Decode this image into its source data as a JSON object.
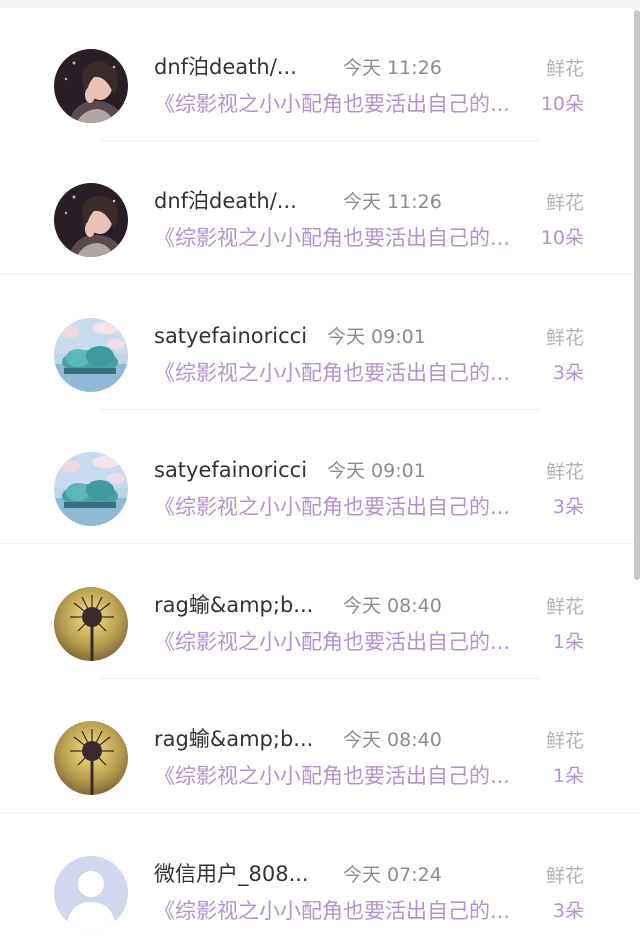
{
  "rows": [
    {
      "name": "dnf泊death/...",
      "time": "今天 11:26",
      "gift_label": "鲜花",
      "novel": "《综影视之小小配角也要活出自己的...",
      "count": "10朵",
      "avatar": "portrait"
    },
    {
      "name": "dnf泊death/...",
      "time": "今天 11:26",
      "gift_label": "鲜花",
      "novel": "《综影视之小小配角也要活出自己的...",
      "count": "10朵",
      "avatar": "portrait"
    },
    {
      "name": "satyefainoricci",
      "time": "今天 09:01",
      "gift_label": "鲜花",
      "novel": "《综影视之小小配角也要活出自己的...",
      "count": "3朵",
      "avatar": "island"
    },
    {
      "name": "satyefainoricci",
      "time": "今天 09:01",
      "gift_label": "鲜花",
      "novel": "《综影视之小小配角也要活出自己的...",
      "count": "3朵",
      "avatar": "island"
    },
    {
      "name": "rag蝓&amp;b...",
      "time": "今天 08:40",
      "gift_label": "鲜花",
      "novel": "《综影视之小小配角也要活出自己的...",
      "count": "1朵",
      "avatar": "dandelion"
    },
    {
      "name": "rag蝓&amp;b...",
      "time": "今天 08:40",
      "gift_label": "鲜花",
      "novel": "《综影视之小小配角也要活出自己的...",
      "count": "1朵",
      "avatar": "dandelion"
    },
    {
      "name": "微信用户_808...",
      "time": "今天 07:24",
      "gift_label": "鲜花",
      "novel": "《综影视之小小配角也要活出自己的...",
      "count": "3朵",
      "avatar": "default-user"
    }
  ]
}
